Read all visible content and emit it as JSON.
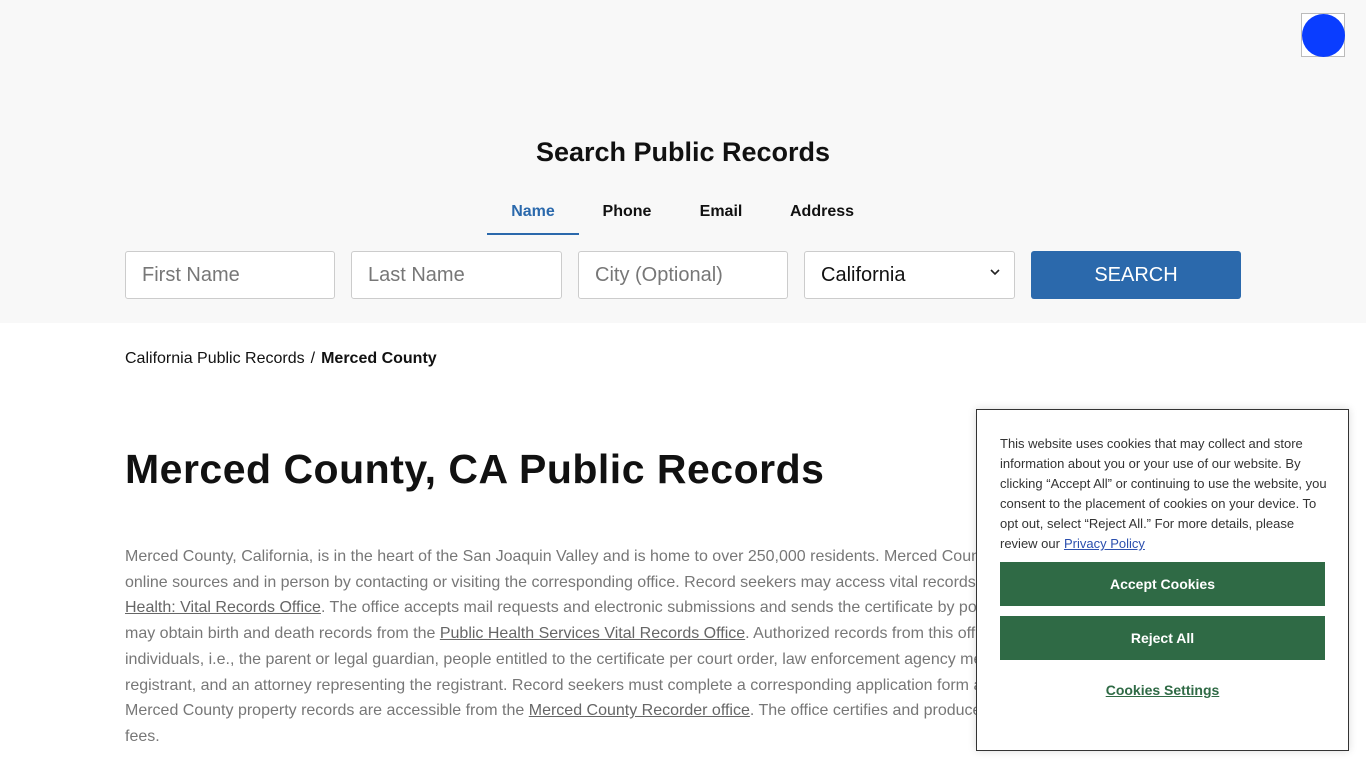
{
  "hero": {
    "title": "Search Public Records",
    "tabs": [
      {
        "label": "Name",
        "active": true
      },
      {
        "label": "Phone",
        "active": false
      },
      {
        "label": "Email",
        "active": false
      },
      {
        "label": "Address",
        "active": false
      }
    ],
    "first_name_placeholder": "First Name",
    "last_name_placeholder": "Last Name",
    "city_placeholder": "City (Optional)",
    "state_selected": "California",
    "search_label": "SEARCH"
  },
  "breadcrumb": {
    "parent": "California Public Records",
    "separator": "/",
    "current": "Merced County"
  },
  "page": {
    "title": "Merced County, CA Public Records",
    "p_1": "Merced County, California, is in the heart of the San Joaquin Valley and is home to over 250,000 residents. Merced Coun",
    "p_2": "online sources and in person by contacting or visiting the corresponding office. Record seekers may access vital records",
    "link_vital_office": "Health: Vital Records Office",
    "p_3": ". The office accepts mail requests and electronic submissions and sends the certificate by po",
    "p_4": "may obtain birth and death records from the ",
    "link_phs_office": "Public Health Services Vital Records Office",
    "p_5": ". Authorized records from this off",
    "p_6": "individuals, i.e., the parent or legal guardian, people entitled to the certificate per court order, law enforcement agency me",
    "p_7": "registrant, and an attorney representing the registrant. Record seekers must complete a corresponding application form a",
    "p_8": "Merced County property records are accessible from the ",
    "link_recorder": "Merced County Recorder office",
    "p_9": ". The office certifies and produce",
    "p_10": "fees."
  },
  "cookie": {
    "text": "This website uses cookies that may collect and store information about you or your use of our website. By clicking “Accept All” or continuing to use the website, you consent to the placement of cookies on your device. To opt out, select “Reject All.” For more details, please review our",
    "privacy_link": "Privacy Policy",
    "accept_label": "Accept Cookies",
    "reject_label": "Reject All",
    "settings_label": "Cookies Settings"
  },
  "colors": {
    "accent": "#2b69ac",
    "cookie_button": "#2f6a45",
    "logo_blue": "#0a3dff"
  },
  "icons": {
    "logo": "broken-image-icon",
    "select_arrow": "chevron-down-icon"
  }
}
